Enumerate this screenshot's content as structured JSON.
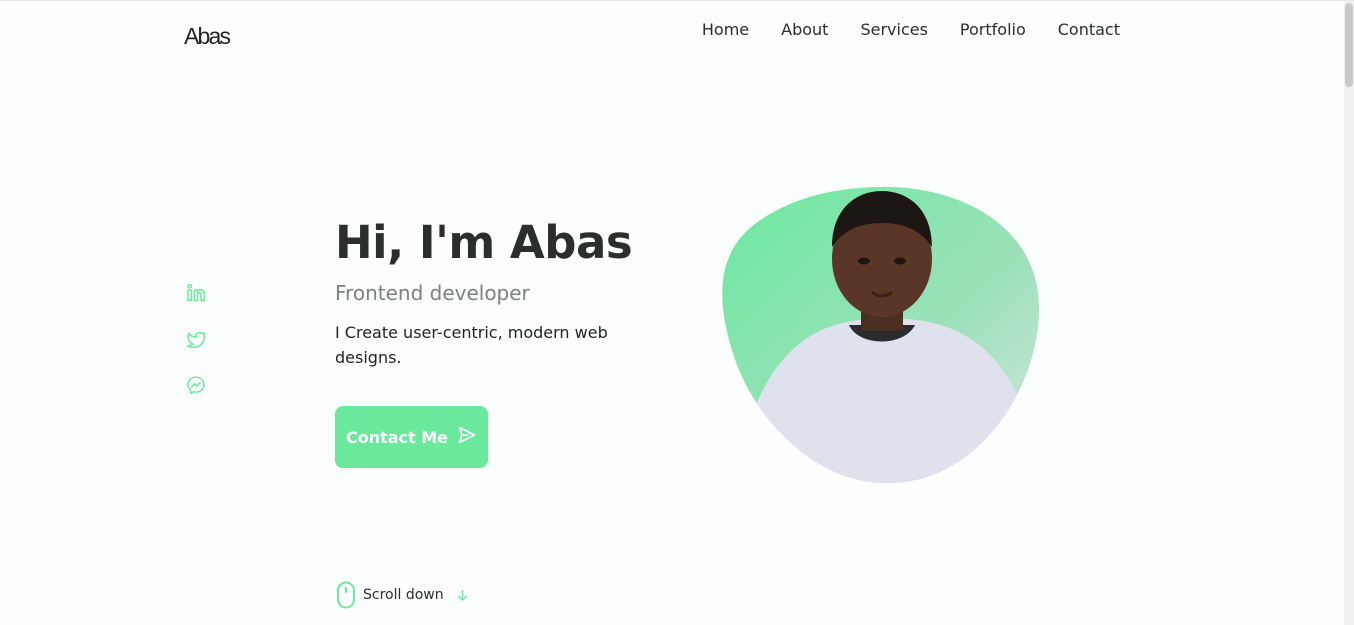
{
  "header": {
    "logo": "Abas",
    "nav": [
      {
        "label": "Home"
      },
      {
        "label": "About"
      },
      {
        "label": "Services"
      },
      {
        "label": "Portfolio"
      },
      {
        "label": "Contact"
      }
    ]
  },
  "socials": [
    {
      "icon": "linkedin-icon"
    },
    {
      "icon": "twitter-icon"
    },
    {
      "icon": "messenger-icon"
    }
  ],
  "hero": {
    "title": "Hi, I'm Abas",
    "subtitle": "Frontend developer",
    "description": "I Create user-centric, modern web designs.",
    "cta_label": "Contact Me",
    "cta_icon": "send-icon",
    "image_icon": "profile-photo"
  },
  "scroll": {
    "label": "Scroll down",
    "mouse_icon": "mouse-icon",
    "arrow_icon": "arrow-down-icon"
  },
  "colors": {
    "accent": "#6ae99d",
    "text": "#2a2f2c",
    "muted": "#7a837d",
    "background": "#fcfefd"
  }
}
